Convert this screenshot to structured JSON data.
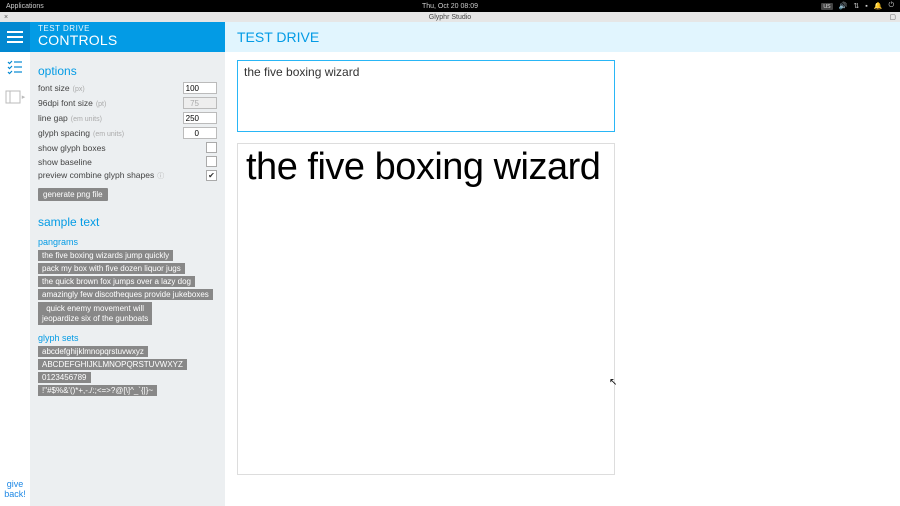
{
  "os": {
    "applications_label": "Applications",
    "clock": "Thu, Oct 20   08:09",
    "keyboard_indicator": "us"
  },
  "window": {
    "title": "Glyphr Studio"
  },
  "rail": {
    "give_back_label": "give\nback!"
  },
  "sidebar": {
    "sub": "TEST DRIVE",
    "title": "CONTROLS",
    "options_heading": "options",
    "options": {
      "font_size": {
        "label": "font size",
        "hint": "(px)",
        "value": 100
      },
      "dpi": {
        "label": "96dpi font size",
        "hint": "(pt)",
        "value": 75,
        "disabled": true
      },
      "line_gap": {
        "label": "line gap",
        "hint": "(em units)",
        "value": 250
      },
      "glyph_spacing": {
        "label": "glyph spacing",
        "hint": "(em units)",
        "value": 0
      },
      "show_glyph_boxes": {
        "label": "show glyph boxes",
        "checked": false
      },
      "show_baseline": {
        "label": "show baseline",
        "checked": false
      },
      "preview_combine": {
        "label": "preview combine glyph shapes",
        "checked": true
      },
      "generate_png_label": "generate png file"
    },
    "sample_text_heading": "sample text",
    "pangrams_heading": "pangrams",
    "pangrams": [
      "the five boxing wizards jump quickly",
      "pack my box with five dozen liquor jugs",
      "the quick brown fox jumps over a lazy dog",
      "amazingly few discotheques provide jukeboxes",
      "quick enemy movement will\njeopardize six of the gunboats"
    ],
    "glyph_sets_heading": "glyph sets",
    "glyph_sets": [
      "abcdefghijklmnopqrstuvwxyz",
      "ABCDEFGHIJKLMNOPQRSTUVWXYZ",
      "0123456789",
      "!\"#$%&'()*+,-./:;<=>?@[\\]^_`{|}~"
    ]
  },
  "main": {
    "header": "TEST DRIVE",
    "input_value": "the five boxing wizard",
    "preview_text": "the five boxing wizard"
  }
}
